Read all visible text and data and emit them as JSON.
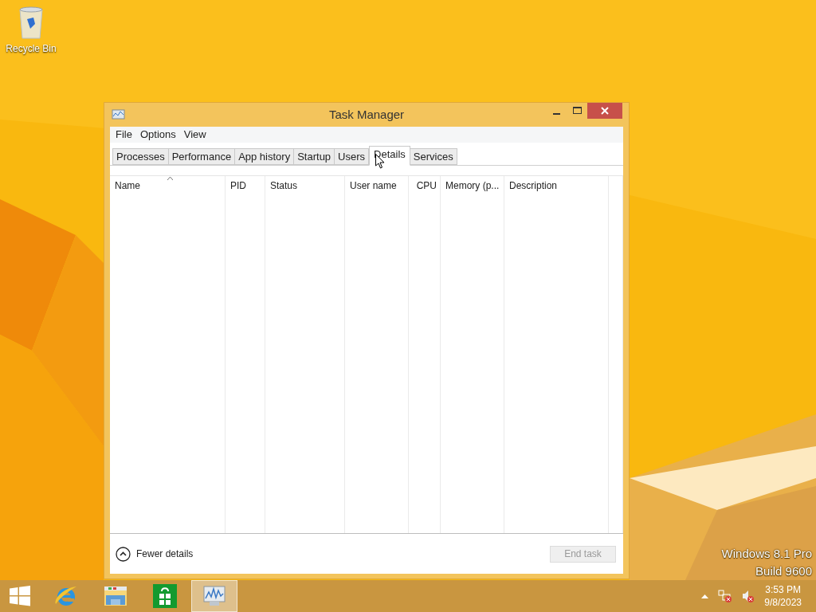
{
  "desktop_icons": [
    {
      "label": "Recycle Bin"
    }
  ],
  "window": {
    "title": "Task Manager",
    "menu": [
      "File",
      "Options",
      "View"
    ],
    "tabs": [
      {
        "label": "Processes",
        "selected": false
      },
      {
        "label": "Performance",
        "selected": false
      },
      {
        "label": "App history",
        "selected": false
      },
      {
        "label": "Startup",
        "selected": false
      },
      {
        "label": "Users",
        "selected": false
      },
      {
        "label": "Details",
        "selected": true
      },
      {
        "label": "Services",
        "selected": false
      }
    ],
    "table": {
      "columns": [
        {
          "label": "Name",
          "sorted": true
        },
        {
          "label": "PID",
          "sorted": false
        },
        {
          "label": "Status",
          "sorted": false
        },
        {
          "label": "User name",
          "sorted": false
        },
        {
          "label": "CPU",
          "sorted": false
        },
        {
          "label": "Memory (p...",
          "sorted": false
        },
        {
          "label": "Description",
          "sorted": false
        }
      ]
    },
    "fewer_details": "Fewer details",
    "end_task": {
      "label": "End task",
      "disabled": true
    }
  },
  "os_edition": [
    "Windows 8.1 Pro",
    "Build 9600"
  ],
  "taskbar": {
    "apps": [
      {
        "kind": "ie",
        "selected": false
      },
      {
        "kind": "explorer",
        "selected": false
      },
      {
        "kind": "store",
        "selected": false
      },
      {
        "kind": "taskmgr",
        "selected": true
      }
    ],
    "clock": {
      "time": "3:53 PM",
      "date": "9/8/2023"
    }
  }
}
